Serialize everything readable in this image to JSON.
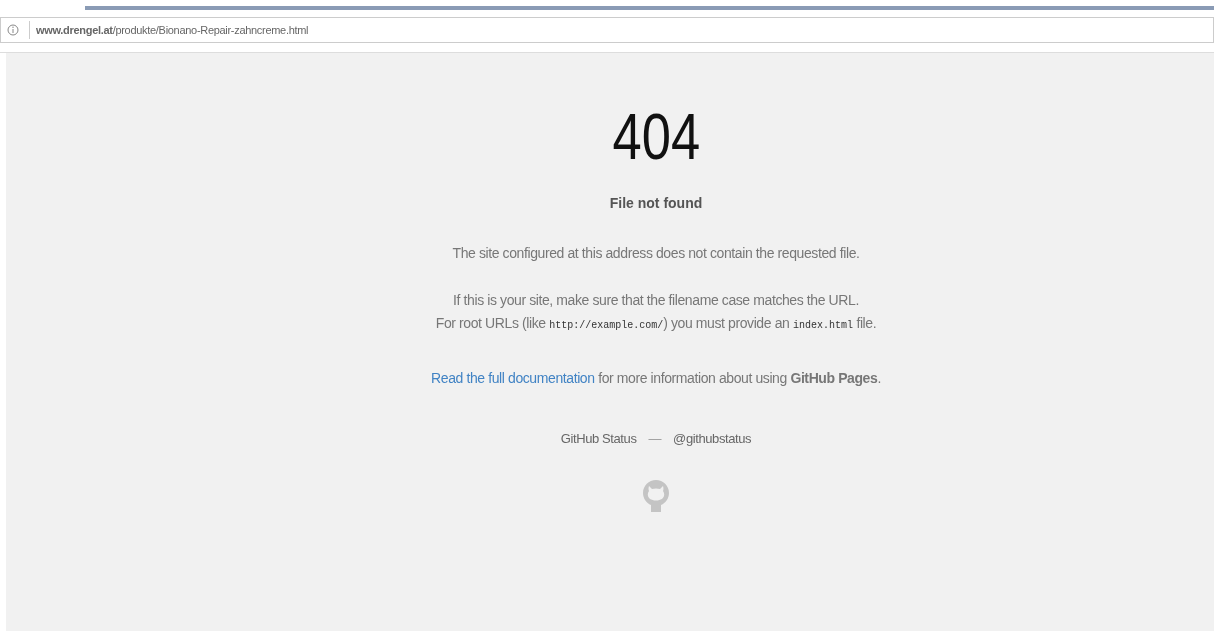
{
  "address_bar": {
    "url": "**www.drengel.at**/produkte/Bionano-Repair-zahncreme.html"
  },
  "page": {
    "code": "404",
    "title": "File not found",
    "message": "The site configured at this address does not contain the requested file.",
    "hint_lines": [
      [
        {
          "kind": "text",
          "text": "If this is your site, make sure that the filename case matches the URL."
        }
      ],
      [
        {
          "kind": "text",
          "text": "For root URLs (like "
        },
        {
          "kind": "code",
          "text": "http://example.com/"
        },
        {
          "kind": "text",
          "text": ") you must provide an "
        },
        {
          "kind": "code",
          "text": "index.html"
        },
        {
          "kind": "text",
          "text": " file."
        }
      ]
    ],
    "docs": {
      "link": "Read the full documentation",
      "text": "for more information about using **GitHub Pages**."
    },
    "footer": {
      "status_link": "GitHub Status",
      "separator": "—",
      "twitter_link": "@githubstatus"
    }
  }
}
